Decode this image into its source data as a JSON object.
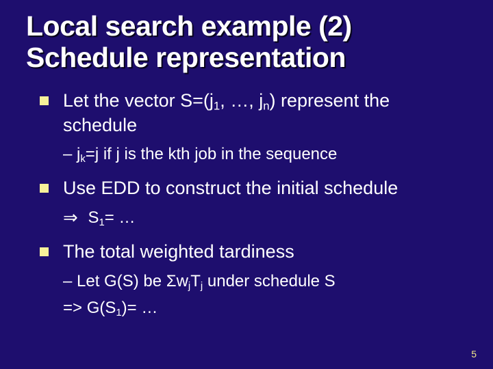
{
  "title_line1": "Local search example (2)",
  "title_line2": "Schedule representation",
  "bullet1_a": "Let the vector S=(j",
  "bullet1_b": ", …, j",
  "bullet1_c": ") represent the schedule",
  "sub1_a": "– j",
  "sub1_b": "=j if j is the kth job in the sequence",
  "bullet2": "Use EDD to construct the initial schedule",
  "sub2_arrow": "⇒",
  "sub2_a": " S",
  "sub2_b": "= …",
  "bullet3": "The total weighted tardiness",
  "sub3a_a": "– Let G(S) be Σw",
  "sub3a_b": "T",
  "sub3a_c": " under schedule S",
  "sub3b_a": "=> G(S",
  "sub3b_b": ")= …",
  "idx_1": "1",
  "idx_n": "n",
  "idx_k": "k",
  "idx_j": "j",
  "page_number": "5"
}
